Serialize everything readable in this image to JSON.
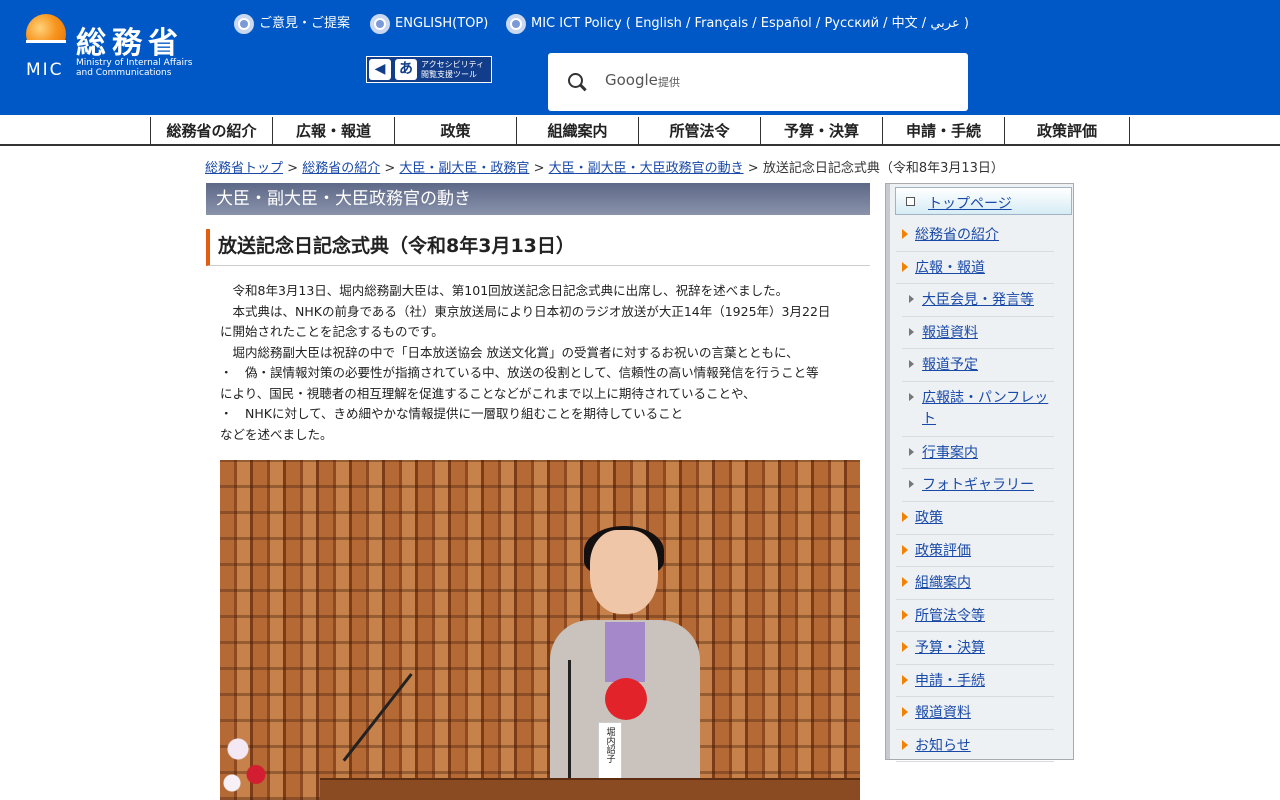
{
  "header": {
    "logo": {
      "kanji": "総務省",
      "mic": "MIC",
      "en_line1": "Ministry of Internal Affairs",
      "en_line2": "and Communications"
    },
    "links": [
      "ご意見・ご提案",
      "ENGLISH(TOP)",
      "MIC ICT Policy ( English / Français / Español / Русский / 中文 / عربي )"
    ],
    "accessibility_tool": {
      "line1": "アクセシビリティ",
      "line2": "閲覧支援ツール"
    },
    "search": {
      "brand": "Google",
      "provided": "提供"
    }
  },
  "nav": [
    "総務省の紹介",
    "広報・報道",
    "政策",
    "組織案内",
    "所管法令",
    "予算・決算",
    "申請・手続",
    "政策評価"
  ],
  "breadcrumb": {
    "items": [
      "総務省トップ",
      "総務省の紹介",
      "大臣・副大臣・政務官",
      "大臣・副大臣・大臣政務官の動き"
    ],
    "separator": ">",
    "current": "放送記念日記念式典（令和8年3月13日）"
  },
  "main": {
    "section": "大臣・副大臣・大臣政務官の動き",
    "title": "放送記念日記念式典（令和8年3月13日）",
    "paragraphs": [
      "　令和8年3月13日、堀内総務副大臣は、第101回放送記念日記念式典に出席し、祝辞を述べました。",
      "　本式典は、NHKの前身である（社）東京放送局により日本初のラジオ放送が大正14年（1925年）3月22日",
      "に開始されたことを記念するものです。",
      "　堀内総務副大臣は祝辞の中で「日本放送協会 放送文化賞」の受賞者に対するお祝いの言葉とともに、",
      "・　偽・誤情報対策の必要性が指摘されている中、放送の役割として、信頼性の高い情報発信を行うこと等",
      "により、国民・視聴者の相互理解を促進することなどがこれまで以上に期待されていることや、",
      "・　NHKに対して、きめ細やかな情報提供に一層取り組むことを期待していること",
      "などを述べました。"
    ],
    "nametag": "堀内詔子"
  },
  "sidebar": {
    "top": "トップページ",
    "items": [
      {
        "label": "総務省の紹介",
        "level": 1
      },
      {
        "label": "広報・報道",
        "level": 1
      },
      {
        "label": "大臣会見・発言等",
        "level": 2
      },
      {
        "label": "報道資料",
        "level": 2
      },
      {
        "label": "報道予定",
        "level": 2
      },
      {
        "label": "広報誌・パンフレット",
        "level": 2
      },
      {
        "label": "行事案内",
        "level": 2
      },
      {
        "label": "フォトギャラリー",
        "level": 2
      },
      {
        "label": "政策",
        "level": 1
      },
      {
        "label": "政策評価",
        "level": 1
      },
      {
        "label": "組織案内",
        "level": 1
      },
      {
        "label": "所管法令等",
        "level": 1
      },
      {
        "label": "予算・決算",
        "level": 1
      },
      {
        "label": "申請・手続",
        "level": 1
      },
      {
        "label": "報道資料",
        "level": 1
      },
      {
        "label": "お知らせ",
        "level": 1
      }
    ]
  },
  "colors": {
    "header_bg": "#0058c6",
    "accent": "#e35d10",
    "link": "#1a4aa8",
    "arrow": "#f08200"
  }
}
